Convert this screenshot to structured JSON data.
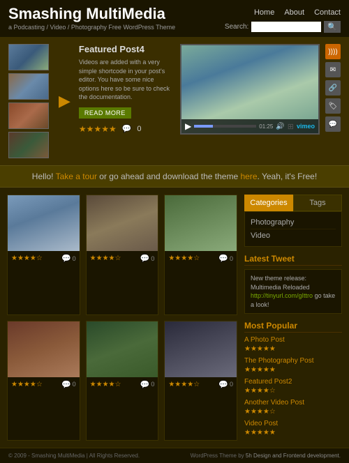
{
  "site": {
    "title": "Smashing MultiMedia",
    "subtitle": "a Podcasting / Video / Photography Free WordPress Theme",
    "nav": [
      "Home",
      "About",
      "Contact"
    ],
    "search_label": "Search:",
    "search_placeholder": ""
  },
  "featured": {
    "post_title": "Featured Post4",
    "post_desc": "Videos are added with a very simple shortcode in your post's editor. You have some nice options here so be sure to check the documentation.",
    "read_more": "READ MORE",
    "stars": "★★★★★",
    "comment_count": "0",
    "video_time": "01:25"
  },
  "promo": {
    "text_before": "Hello! ",
    "link1": "Take a tour",
    "text_middle": " or go ahead and download the theme ",
    "link2": "here",
    "text_after": ". Yeah, it's Free!"
  },
  "posts": [
    {
      "id": 1,
      "img_class": "post-img-1",
      "stars": "★★★★☆",
      "comments": "0"
    },
    {
      "id": 2,
      "img_class": "post-img-2",
      "stars": "★★★★☆",
      "comments": "0"
    },
    {
      "id": 3,
      "img_class": "post-img-3",
      "stars": "★★★★☆",
      "comments": "0"
    },
    {
      "id": 4,
      "img_class": "post-img-4",
      "stars": "★★★★☆",
      "comments": "0"
    },
    {
      "id": 5,
      "img_class": "post-img-5",
      "stars": "★★★★☆",
      "comments": "0"
    },
    {
      "id": 6,
      "img_class": "post-img-6",
      "stars": "★★★★☆",
      "comments": "0"
    }
  ],
  "sidebar": {
    "tabs": [
      "Categories",
      "Tags"
    ],
    "active_tab": "Categories",
    "categories": [
      "Photography",
      "Video"
    ],
    "latest_tweet_title": "Latest Tweet",
    "tweet_text": "New theme release: Multimedia Reloaded",
    "tweet_link": "http://tinyurl.com/gIttro",
    "tweet_link_text": "http://tinyurl.com/gIttro",
    "tweet_suffix": " go take a look!",
    "most_popular_title": "Most Popular",
    "popular_items": [
      {
        "title": "A Photo Post",
        "stars": "★★★★★"
      },
      {
        "title": "The Photography Post",
        "stars": "★★★★★"
      },
      {
        "title": "Featured Post2",
        "stars": "★★★★☆"
      },
      {
        "title": "Another Video Post",
        "stars": "★★★★☆"
      },
      {
        "title": "Video Post",
        "stars": "★★★★★"
      }
    ]
  },
  "footer": {
    "left": "© 2009 - Smashing MultiMedia  |  All Rights Reserved.",
    "right_text": "WordPress Theme by",
    "right_link": "5h Design and Frontend development."
  }
}
